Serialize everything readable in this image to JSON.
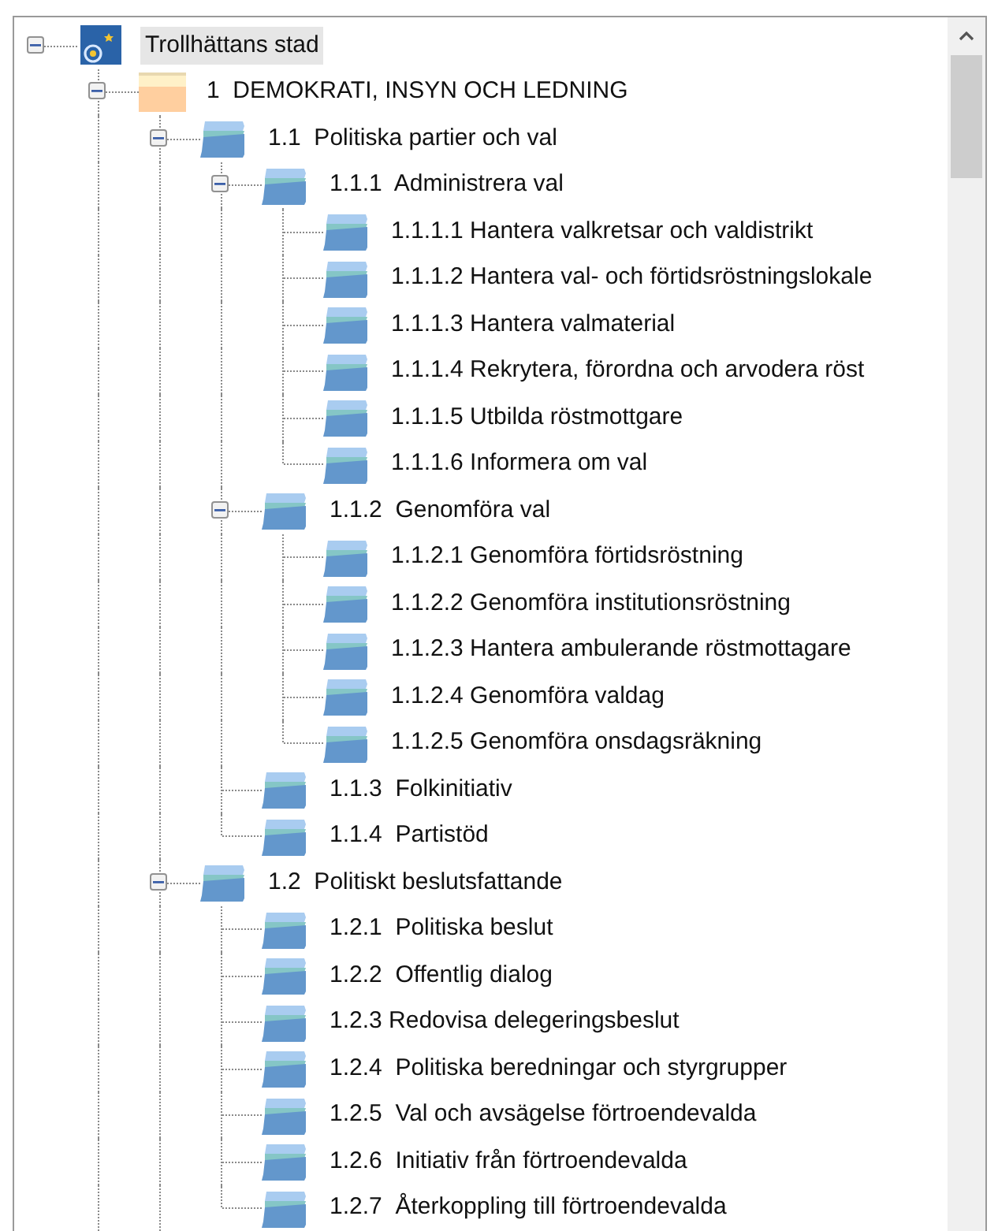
{
  "tree": {
    "nodes": [
      {
        "label": "Trollhättans stad",
        "kind": "root",
        "expanded": true,
        "selected": true,
        "children": [
          {
            "label": "1  DEMOKRATI, INSYN OCH LEDNING",
            "kind": "section",
            "expanded": true,
            "selected": false,
            "continues": true,
            "children": [
              {
                "label": "1.1  Politiska partier och val",
                "kind": "folder",
                "expanded": true,
                "selected": false,
                "children": [
                  {
                    "label": "1.1.1  Administrera val",
                    "kind": "folder",
                    "expanded": true,
                    "selected": false,
                    "children": [
                      {
                        "label": "1.1.1.1 Hantera valkretsar och valdistrikt",
                        "kind": "folder",
                        "selected": false
                      },
                      {
                        "label": "1.1.1.2 Hantera val- och förtidsröstningslokale",
                        "kind": "folder",
                        "selected": false
                      },
                      {
                        "label": "1.1.1.3 Hantera valmaterial",
                        "kind": "folder",
                        "selected": false
                      },
                      {
                        "label": "1.1.1.4 Rekrytera, förordna och arvodera röst",
                        "kind": "folder",
                        "selected": false
                      },
                      {
                        "label": "1.1.1.5 Utbilda röstmottgare",
                        "kind": "folder",
                        "selected": false
                      },
                      {
                        "label": "1.1.1.6 Informera om val",
                        "kind": "folder",
                        "selected": false
                      }
                    ]
                  },
                  {
                    "label": "1.1.2  Genomföra val",
                    "kind": "folder",
                    "expanded": true,
                    "selected": false,
                    "children": [
                      {
                        "label": "1.1.2.1 Genomföra förtidsröstning",
                        "kind": "folder",
                        "selected": false
                      },
                      {
                        "label": "1.1.2.2 Genomföra institutionsröstning",
                        "kind": "folder",
                        "selected": false
                      },
                      {
                        "label": "1.1.2.3 Hantera ambulerande röstmottagare",
                        "kind": "folder",
                        "selected": false
                      },
                      {
                        "label": "1.1.2.4 Genomföra valdag",
                        "kind": "folder",
                        "selected": false
                      },
                      {
                        "label": "1.1.2.5 Genomföra onsdagsräkning",
                        "kind": "folder",
                        "selected": false
                      }
                    ]
                  },
                  {
                    "label": "1.1.3  Folkinitiativ",
                    "kind": "folder",
                    "selected": false
                  },
                  {
                    "label": "1.1.4  Partistöd",
                    "kind": "folder",
                    "selected": false
                  }
                ]
              },
              {
                "label": "1.2  Politiskt beslutsfattande",
                "kind": "folder",
                "expanded": true,
                "selected": false,
                "continues": true,
                "children": [
                  {
                    "label": "1.2.1  Politiska beslut",
                    "kind": "folder",
                    "selected": false
                  },
                  {
                    "label": "1.2.2  Offentlig dialog",
                    "kind": "folder",
                    "selected": false
                  },
                  {
                    "label": "1.2.3 Redovisa delegeringsbeslut",
                    "kind": "folder",
                    "selected": false
                  },
                  {
                    "label": "1.2.4  Politiska beredningar och styrgrupper",
                    "kind": "folder",
                    "selected": false
                  },
                  {
                    "label": "1.2.5  Val och avsägelse förtroendevalda",
                    "kind": "folder",
                    "selected": false
                  },
                  {
                    "label": "1.2.6  Initiativ från förtroendevalda",
                    "kind": "folder",
                    "selected": false
                  },
                  {
                    "label": "1.2.7  Återkoppling till förtroendevalda",
                    "kind": "folder",
                    "selected": false
                  }
                ]
              }
            ]
          }
        ]
      }
    ]
  }
}
